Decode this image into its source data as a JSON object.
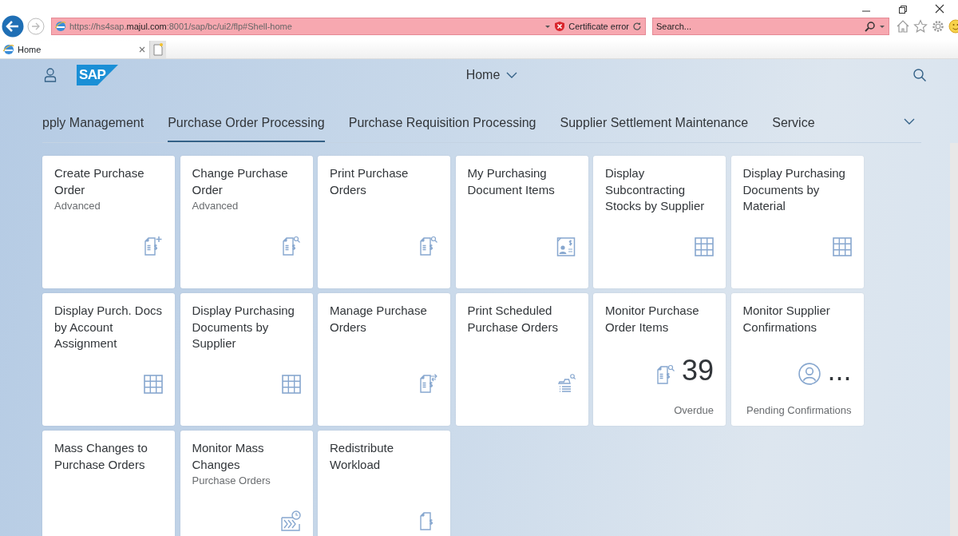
{
  "browser": {
    "url": "https://hs4sap.**majul.com**:8001/sap/bc/ui2/flp#Shell-home",
    "certificate_error": "Certificate error",
    "search": {
      "placeholder": "Search..."
    },
    "tabs": [
      {
        "label": "Home",
        "selected": true
      }
    ]
  },
  "shell": {
    "logo": "SAP",
    "title": "Home"
  },
  "groups": [
    {
      "label": "pply Management",
      "selected": false
    },
    {
      "label": "Purchase Order Processing",
      "selected": true
    },
    {
      "label": "Purchase Requisition Processing",
      "selected": false
    },
    {
      "label": "Supplier Settlement Maintenance",
      "selected": false
    },
    {
      "label": "Service",
      "selected": false
    }
  ],
  "tiles": [
    {
      "kind": "launch",
      "title": "Create Purchase Order",
      "subtitle": "Advanced"
    },
    {
      "kind": "launch",
      "title": "Change Purchase Order",
      "subtitle": "Advanced"
    },
    {
      "kind": "launch",
      "title": "Print Purchase Orders"
    },
    {
      "kind": "launch",
      "title": "My Purchasing Document Items"
    },
    {
      "kind": "launch",
      "title": "Display Subcontracting Stocks by Supplier"
    },
    {
      "kind": "launch",
      "title": "Display Purchasing Documents by Material"
    },
    {
      "kind": "launch",
      "title": "Display Purch. Docs by Account Assignment"
    },
    {
      "kind": "launch",
      "title": "Display Purchasing Documents by Supplier"
    },
    {
      "kind": "launch",
      "title": "Manage Purchase Orders"
    },
    {
      "kind": "launch",
      "title": "Print Scheduled Purchase Orders"
    },
    {
      "kind": "kpi",
      "title": "Monitor Purchase Order Items",
      "value": "39",
      "footer": "Overdue"
    },
    {
      "kind": "kpi",
      "title": "Monitor Supplier Confirmations",
      "value": "...",
      "footer": "Pending Confirmations"
    },
    {
      "kind": "launch",
      "title": "Mass Changes to Purchase Orders"
    },
    {
      "kind": "launch",
      "title": "Monitor Mass Changes",
      "subtitle": "Purchase Orders"
    },
    {
      "kind": "launch",
      "title": "Redistribute Workload"
    }
  ]
}
